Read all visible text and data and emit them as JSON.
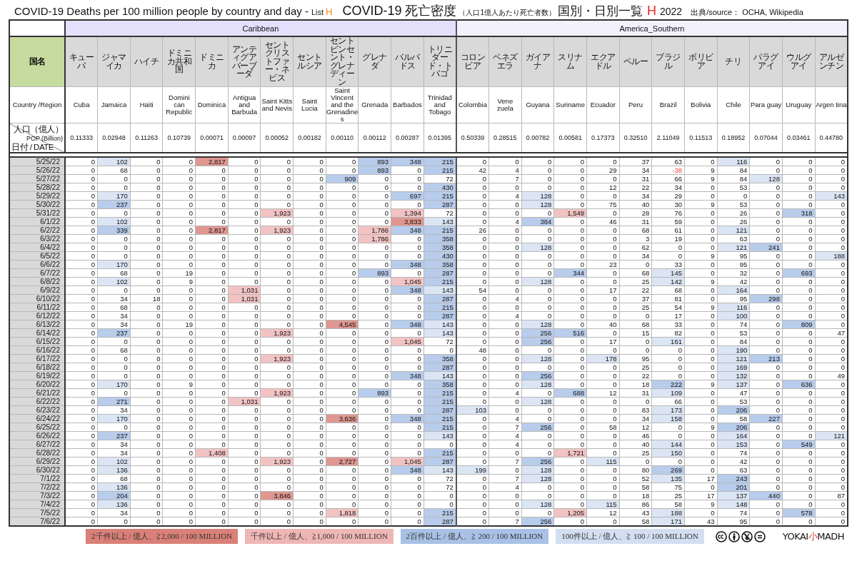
{
  "title": {
    "english": "COVID-19 Deaths per 100 million people by country and day -",
    "list_label": "List",
    "list_letter": "H",
    "japanese": "COVID-19 死亡密度",
    "japanese_note": "（人口1億人あたり死亡者数）",
    "japanese_list": "国別・日別一覧",
    "japanese_letter": "H",
    "year": "2022",
    "source": "出典/source： OCHA, Wikipedia"
  },
  "table": {
    "row_labels": {
      "jp": "国名",
      "en": "Country /Region",
      "pop": "人口（億人）",
      "pop_en": "POP",
      "pop_en_unit": "(Billion)",
      "date": "日付 / DATE"
    },
    "groups": [
      {
        "name": "Caribbean",
        "color": "#e4e0fc",
        "countries": [
          {
            "jp": "キューバ",
            "en": "Cuba",
            "pop": "0.11333"
          },
          {
            "jp": "ジャマイカ",
            "en": "Jamaica",
            "pop": "0.02948"
          },
          {
            "jp": "ハイチ",
            "en": "Haiti",
            "pop": "0.11263"
          },
          {
            "jp": "ドミニカ共和国",
            "en": "Domini can Republic",
            "pop": "0.10739"
          },
          {
            "jp": "ドミニカ",
            "en": "Dominica",
            "pop": "0.00071"
          },
          {
            "jp": "アンティグアバーブーダ",
            "en": "Antigua and Barbuda",
            "pop": "0.00097"
          },
          {
            "jp": "セントクリストファー・ネビス",
            "en": "Saint Kitts and Nevis",
            "pop": "0.00052"
          },
          {
            "jp": "セントルシア",
            "en": "Saint Lucia",
            "pop": "0.00182"
          },
          {
            "jp": "セントビンセント・グレナディーン",
            "en": "Saint Vincent and the Grenadines",
            "pop": "0.00110"
          },
          {
            "jp": "グレナダ",
            "en": "Grenada",
            "pop": "0.00112"
          },
          {
            "jp": "バルバドス",
            "en": "Barbados",
            "pop": "0.00287"
          },
          {
            "jp": "トリニダード・トバゴ",
            "en": "Trinidad and Tobago",
            "pop": "0.01395"
          }
        ]
      },
      {
        "name": "America_Southern",
        "color": "#f3f1fe",
        "countries": [
          {
            "jp": "コロンビア",
            "en": "Colombia",
            "pop": "0.50339"
          },
          {
            "jp": "ベネズエラ",
            "en": "Vene zuela",
            "pop": "0.28515"
          },
          {
            "jp": "ガイアナ",
            "en": "Guyana",
            "pop": "0.00782"
          },
          {
            "jp": "スリナム",
            "en": "Suriname",
            "pop": "0.00581"
          },
          {
            "jp": "エクアドル",
            "en": "Ecuador",
            "pop": "0.17373"
          },
          {
            "jp": "ペルー",
            "en": "Peru",
            "pop": "0.32510"
          },
          {
            "jp": "ブラジル",
            "en": "Brazil",
            "pop": "2.11049"
          },
          {
            "jp": "ボリビア",
            "en": "Bolivia",
            "pop": "0.11513"
          },
          {
            "jp": "チリ",
            "en": "Chile",
            "pop": "0.18952"
          },
          {
            "jp": "パラグアイ",
            "en": "Para guay",
            "pop": "0.07044"
          },
          {
            "jp": "ウルグアイ",
            "en": "Uruguay",
            "pop": "0.03461"
          },
          {
            "jp": "アルゼンチン",
            "en": "Argen tina",
            "pop": "0.44780"
          }
        ]
      }
    ],
    "rows": [
      {
        "date": "5/25/22",
        "values": [
          "0",
          "102",
          "0",
          "0",
          "2,817",
          "0",
          "0",
          "0",
          "0",
          "893",
          "348",
          "215",
          "0",
          "0",
          "0",
          "0",
          "0",
          "37",
          "63",
          "0",
          "116",
          "0",
          "0",
          "0"
        ]
      },
      {
        "date": "5/26/22",
        "values": [
          "0",
          "68",
          "0",
          "0",
          "0",
          "0",
          "0",
          "0",
          "0",
          "893",
          "0",
          "215",
          "42",
          "4",
          "0",
          "0",
          "29",
          "34",
          "-38",
          "9",
          "84",
          "0",
          "0",
          "0"
        ]
      },
      {
        "date": "5/27/22",
        "values": [
          "0",
          "0",
          "0",
          "0",
          "0",
          "0",
          "0",
          "0",
          "909",
          "0",
          "0",
          "72",
          "0",
          "7",
          "0",
          "0",
          "0",
          "31",
          "66",
          "9",
          "84",
          "128",
          "0",
          "0"
        ]
      },
      {
        "date": "5/28/22",
        "values": [
          "0",
          "0",
          "0",
          "0",
          "0",
          "0",
          "0",
          "0",
          "0",
          "0",
          "0",
          "430",
          "0",
          "0",
          "0",
          "0",
          "12",
          "22",
          "34",
          "0",
          "53",
          "0",
          "0",
          "0"
        ]
      },
      {
        "date": "5/29/22",
        "values": [
          "0",
          "170",
          "0",
          "0",
          "0",
          "0",
          "0",
          "0",
          "0",
          "0",
          "697",
          "215",
          "0",
          "4",
          "128",
          "0",
          "0",
          "34",
          "29",
          "0",
          "0",
          "0",
          "0",
          "143"
        ]
      },
      {
        "date": "5/30/22",
        "values": [
          "0",
          "237",
          "0",
          "0",
          "0",
          "0",
          "0",
          "0",
          "0",
          "0",
          "0",
          "287",
          "0",
          "0",
          "128",
          "0",
          "75",
          "40",
          "30",
          "9",
          "53",
          "0",
          "0",
          "0"
        ]
      },
      {
        "date": "5/31/22",
        "values": [
          "0",
          "0",
          "0",
          "0",
          "0",
          "0",
          "1,923",
          "0",
          "0",
          "0",
          "1,394",
          "72",
          "0",
          "0",
          "0",
          "1,549",
          "0",
          "28",
          "76",
          "0",
          "26",
          "0",
          "318",
          "0"
        ]
      },
      {
        "date": "6/1/22",
        "values": [
          "0",
          "102",
          "0",
          "0",
          "0",
          "0",
          "0",
          "0",
          "0",
          "0",
          "3,833",
          "143",
          "0",
          "4",
          "384",
          "0",
          "46",
          "31",
          "59",
          "0",
          "26",
          "0",
          "0",
          "0"
        ]
      },
      {
        "date": "6/2/22",
        "values": [
          "0",
          "339",
          "0",
          "0",
          "2,817",
          "0",
          "1,923",
          "0",
          "0",
          "1,786",
          "348",
          "215",
          "26",
          "0",
          "0",
          "0",
          "0",
          "68",
          "61",
          "0",
          "121",
          "0",
          "0",
          "0"
        ]
      },
      {
        "date": "6/3/22",
        "values": [
          "0",
          "0",
          "0",
          "0",
          "0",
          "0",
          "0",
          "0",
          "0",
          "1,786",
          "0",
          "358",
          "0",
          "0",
          "0",
          "0",
          "0",
          "3",
          "19",
          "0",
          "63",
          "0",
          "0",
          "0"
        ]
      },
      {
        "date": "6/4/22",
        "values": [
          "0",
          "0",
          "0",
          "0",
          "0",
          "0",
          "0",
          "0",
          "0",
          "0",
          "0",
          "358",
          "0",
          "0",
          "128",
          "0",
          "0",
          "62",
          "0",
          "0",
          "121",
          "241",
          "0",
          "0"
        ]
      },
      {
        "date": "6/5/22",
        "values": [
          "0",
          "0",
          "0",
          "0",
          "0",
          "0",
          "0",
          "0",
          "0",
          "0",
          "0",
          "430",
          "0",
          "0",
          "0",
          "0",
          "0",
          "34",
          "0",
          "9",
          "95",
          "0",
          "0",
          "188"
        ]
      },
      {
        "date": "6/6/22",
        "values": [
          "0",
          "170",
          "0",
          "0",
          "0",
          "0",
          "0",
          "0",
          "0",
          "0",
          "348",
          "358",
          "0",
          "0",
          "0",
          "0",
          "23",
          "0",
          "33",
          "0",
          "95",
          "0",
          "0",
          "0"
        ]
      },
      {
        "date": "6/7/22",
        "values": [
          "0",
          "68",
          "0",
          "19",
          "0",
          "0",
          "0",
          "0",
          "0",
          "893",
          "0",
          "287",
          "0",
          "0",
          "0",
          "344",
          "0",
          "68",
          "145",
          "0",
          "32",
          "0",
          "693",
          "0"
        ]
      },
      {
        "date": "6/8/22",
        "values": [
          "0",
          "102",
          "0",
          "9",
          "0",
          "0",
          "0",
          "0",
          "0",
          "0",
          "1,045",
          "215",
          "0",
          "0",
          "128",
          "0",
          "0",
          "25",
          "142",
          "9",
          "42",
          "0",
          "0",
          "0"
        ]
      },
      {
        "date": "6/9/22",
        "values": [
          "0",
          "0",
          "0",
          "0",
          "0",
          "1,031",
          "0",
          "0",
          "0",
          "0",
          "348",
          "143",
          "54",
          "0",
          "0",
          "0",
          "17",
          "22",
          "68",
          "0",
          "164",
          "0",
          "0",
          "0"
        ]
      },
      {
        "date": "6/10/22",
        "values": [
          "0",
          "34",
          "18",
          "0",
          "0",
          "1,031",
          "0",
          "0",
          "0",
          "0",
          "0",
          "287",
          "0",
          "4",
          "0",
          "0",
          "0",
          "37",
          "81",
          "0",
          "95",
          "298",
          "0",
          "0"
        ]
      },
      {
        "date": "6/11/22",
        "values": [
          "0",
          "68",
          "0",
          "0",
          "0",
          "0",
          "0",
          "0",
          "0",
          "0",
          "0",
          "215",
          "0",
          "0",
          "0",
          "0",
          "0",
          "25",
          "54",
          "9",
          "116",
          "0",
          "0",
          "0"
        ]
      },
      {
        "date": "6/12/22",
        "values": [
          "0",
          "34",
          "0",
          "0",
          "0",
          "0",
          "0",
          "0",
          "0",
          "0",
          "0",
          "287",
          "0",
          "4",
          "0",
          "0",
          "0",
          "0",
          "17",
          "0",
          "100",
          "0",
          "0",
          "0"
        ]
      },
      {
        "date": "6/13/22",
        "values": [
          "0",
          "34",
          "0",
          "19",
          "0",
          "0",
          "0",
          "0",
          "4,545",
          "0",
          "348",
          "143",
          "0",
          "0",
          "128",
          "0",
          "40",
          "68",
          "33",
          "0",
          "74",
          "0",
          "809",
          "0"
        ]
      },
      {
        "date": "6/14/22",
        "values": [
          "0",
          "237",
          "0",
          "0",
          "0",
          "0",
          "1,923",
          "0",
          "0",
          "0",
          "0",
          "143",
          "0",
          "0",
          "256",
          "516",
          "0",
          "15",
          "82",
          "0",
          "53",
          "0",
          "0",
          "47"
        ]
      },
      {
        "date": "6/15/22",
        "values": [
          "0",
          "0",
          "0",
          "0",
          "0",
          "0",
          "0",
          "0",
          "0",
          "0",
          "1,045",
          "72",
          "0",
          "0",
          "256",
          "0",
          "17",
          "0",
          "161",
          "0",
          "84",
          "0",
          "0",
          "0"
        ]
      },
      {
        "date": "6/16/22",
        "values": [
          "0",
          "68",
          "0",
          "0",
          "0",
          "0",
          "0",
          "0",
          "0",
          "0",
          "0",
          "0",
          "48",
          "0",
          "0",
          "0",
          "0",
          "0",
          "0",
          "0",
          "190",
          "0",
          "0",
          "0"
        ]
      },
      {
        "date": "6/17/22",
        "values": [
          "0",
          "0",
          "0",
          "0",
          "0",
          "0",
          "1,923",
          "0",
          "0",
          "0",
          "0",
          "358",
          "0",
          "0",
          "128",
          "0",
          "178",
          "95",
          "0",
          "0",
          "121",
          "213",
          "0",
          "0"
        ]
      },
      {
        "date": "6/18/22",
        "values": [
          "0",
          "0",
          "0",
          "0",
          "0",
          "0",
          "0",
          "0",
          "0",
          "0",
          "0",
          "287",
          "0",
          "0",
          "0",
          "0",
          "0",
          "25",
          "0",
          "0",
          "169",
          "0",
          "0",
          "0"
        ]
      },
      {
        "date": "6/19/22",
        "values": [
          "0",
          "0",
          "0",
          "0",
          "0",
          "0",
          "0",
          "0",
          "0",
          "0",
          "348",
          "143",
          "0",
          "0",
          "256",
          "0",
          "0",
          "22",
          "0",
          "0",
          "132",
          "0",
          "0",
          "49"
        ]
      },
      {
        "date": "6/20/22",
        "values": [
          "0",
          "170",
          "0",
          "9",
          "0",
          "0",
          "0",
          "0",
          "0",
          "0",
          "0",
          "358",
          "0",
          "0",
          "128",
          "0",
          "0",
          "18",
          "222",
          "9",
          "137",
          "0",
          "636",
          "0"
        ]
      },
      {
        "date": "6/21/22",
        "values": [
          "0",
          "0",
          "0",
          "0",
          "0",
          "0",
          "1,923",
          "0",
          "0",
          "893",
          "0",
          "215",
          "0",
          "4",
          "0",
          "688",
          "12",
          "31",
          "109",
          "0",
          "47",
          "0",
          "0",
          "0"
        ]
      },
      {
        "date": "6/22/22",
        "values": [
          "0",
          "271",
          "0",
          "0",
          "0",
          "1,031",
          "0",
          "0",
          "0",
          "0",
          "0",
          "215",
          "0",
          "0",
          "128",
          "0",
          "0",
          "0",
          "66",
          "0",
          "53",
          "0",
          "0",
          "0"
        ]
      },
      {
        "date": "6/23/22",
        "values": [
          "0",
          "34",
          "0",
          "0",
          "0",
          "0",
          "0",
          "0",
          "0",
          "0",
          "0",
          "287",
          "103",
          "0",
          "0",
          "0",
          "0",
          "83",
          "173",
          "0",
          "206",
          "0",
          "0",
          "0"
        ]
      },
      {
        "date": "6/24/22",
        "values": [
          "0",
          "170",
          "0",
          "0",
          "0",
          "0",
          "0",
          "0",
          "3,636",
          "0",
          "348",
          "215",
          "0",
          "4",
          "0",
          "0",
          "0",
          "34",
          "158",
          "0",
          "58",
          "227",
          "0",
          "0"
        ]
      },
      {
        "date": "6/25/22",
        "values": [
          "0",
          "0",
          "0",
          "0",
          "0",
          "0",
          "0",
          "0",
          "0",
          "0",
          "0",
          "215",
          "0",
          "7",
          "256",
          "0",
          "58",
          "12",
          "0",
          "9",
          "206",
          "0",
          "0",
          "0"
        ]
      },
      {
        "date": "6/26/22",
        "values": [
          "0",
          "237",
          "0",
          "0",
          "0",
          "0",
          "0",
          "0",
          "0",
          "0",
          "0",
          "143",
          "0",
          "4",
          "0",
          "0",
          "0",
          "46",
          "0",
          "0",
          "164",
          "0",
          "0",
          "121"
        ]
      },
      {
        "date": "6/27/22",
        "values": [
          "0",
          "34",
          "0",
          "0",
          "0",
          "0",
          "0",
          "0",
          "0",
          "0",
          "0",
          "0",
          "0",
          "4",
          "0",
          "0",
          "0",
          "40",
          "144",
          "0",
          "153",
          "0",
          "549",
          "0"
        ]
      },
      {
        "date": "6/28/22",
        "values": [
          "0",
          "34",
          "0",
          "0",
          "1,408",
          "0",
          "0",
          "0",
          "0",
          "0",
          "0",
          "215",
          "0",
          "0",
          "0",
          "1,721",
          "0",
          "25",
          "150",
          "0",
          "74",
          "0",
          "0",
          "0"
        ]
      },
      {
        "date": "6/29/22",
        "values": [
          "0",
          "102",
          "0",
          "0",
          "0",
          "0",
          "1,923",
          "0",
          "2,727",
          "0",
          "1,045",
          "287",
          "0",
          "7",
          "256",
          "0",
          "115",
          "0",
          "0",
          "0",
          "42",
          "0",
          "0",
          "0"
        ]
      },
      {
        "date": "6/30/22",
        "values": [
          "0",
          "136",
          "0",
          "0",
          "0",
          "0",
          "0",
          "0",
          "0",
          "0",
          "348",
          "143",
          "199",
          "0",
          "128",
          "0",
          "0",
          "80",
          "269",
          "0",
          "63",
          "0",
          "0",
          "0"
        ]
      },
      {
        "date": "7/1/22",
        "values": [
          "0",
          "68",
          "0",
          "0",
          "0",
          "0",
          "0",
          "0",
          "0",
          "0",
          "0",
          "72",
          "0",
          "7",
          "128",
          "0",
          "0",
          "52",
          "135",
          "17",
          "243",
          "0",
          "0",
          "0"
        ]
      },
      {
        "date": "7/2/22",
        "values": [
          "0",
          "136",
          "0",
          "0",
          "0",
          "0",
          "0",
          "0",
          "0",
          "0",
          "0",
          "72",
          "0",
          "4",
          "0",
          "0",
          "0",
          "58",
          "75",
          "0",
          "201",
          "0",
          "0",
          "0"
        ]
      },
      {
        "date": "7/3/22",
        "values": [
          "0",
          "204",
          "0",
          "0",
          "0",
          "0",
          "3,846",
          "0",
          "0",
          "0",
          "0",
          "0",
          "0",
          "0",
          "0",
          "0",
          "0",
          "18",
          "25",
          "17",
          "137",
          "440",
          "0",
          "87"
        ]
      },
      {
        "date": "7/4/22",
        "values": [
          "0",
          "136",
          "0",
          "0",
          "0",
          "0",
          "0",
          "0",
          "0",
          "0",
          "0",
          "0",
          "0",
          "0",
          "128",
          "0",
          "115",
          "86",
          "58",
          "9",
          "148",
          "0",
          "0",
          "0"
        ]
      },
      {
        "date": "7/5/22",
        "values": [
          "0",
          "34",
          "0",
          "0",
          "0",
          "0",
          "0",
          "0",
          "1,818",
          "0",
          "0",
          "215",
          "0",
          "0",
          "0",
          "1,205",
          "12",
          "43",
          "188",
          "0",
          "74",
          "0",
          "578",
          "0"
        ]
      },
      {
        "date": "7/6/22",
        "values": [
          "0",
          "0",
          "0",
          "0",
          "0",
          "0",
          "0",
          "0",
          "0",
          "0",
          "0",
          "287",
          "0",
          "7",
          "256",
          "0",
          "0",
          "58",
          "171",
          "43",
          "95",
          "0",
          "0",
          "0"
        ]
      }
    ]
  },
  "legend": [
    {
      "text": "2千件以上 / 億人、≧2,000 / 100 MILLION",
      "color": "#d98078"
    },
    {
      "text": "千件以上 / 億人、≧1,000 / 100 MILLION",
      "color": "#efb6b6"
    },
    {
      "text": "2百件以上 / 億人、≧ 200 / 100 MILLION",
      "color": "#a9c1e6"
    },
    {
      "text": "100件以上 / 億人、≧ 100 / 100 MILLION",
      "color": "#d3dff1"
    }
  ],
  "logo": {
    "left": "YOKAI",
    "middle": "小",
    "right": "MADH"
  }
}
